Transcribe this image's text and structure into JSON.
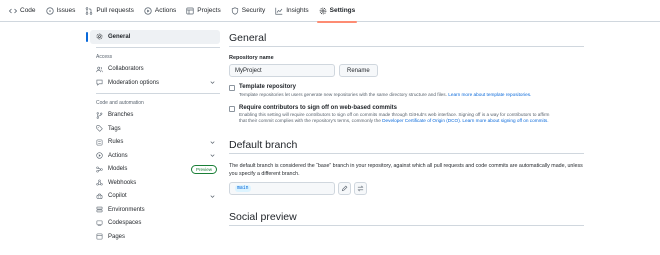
{
  "topnav": {
    "tabs": [
      {
        "label": "Code",
        "icon": "code-icon"
      },
      {
        "label": "Issues",
        "icon": "issue-icon"
      },
      {
        "label": "Pull requests",
        "icon": "pull-request-icon"
      },
      {
        "label": "Actions",
        "icon": "play-icon"
      },
      {
        "label": "Projects",
        "icon": "table-icon"
      },
      {
        "label": "Security",
        "icon": "shield-icon"
      },
      {
        "label": "Insights",
        "icon": "graph-icon"
      },
      {
        "label": "Settings",
        "icon": "gear-icon"
      }
    ],
    "active": "Settings"
  },
  "sidebar": {
    "general": "General",
    "access_heading": "Access",
    "collaborators": "Collaborators",
    "moderation": "Moderation options",
    "code_heading": "Code and automation",
    "branches": "Branches",
    "tags": "Tags",
    "rules": "Rules",
    "actions": "Actions",
    "models": "Models",
    "models_badge": "Preview",
    "webhooks": "Webhooks",
    "copilot": "Copilot",
    "environments": "Environments",
    "codespaces": "Codespaces",
    "pages": "Pages"
  },
  "general": {
    "title": "General",
    "repo_name_label": "Repository name",
    "repo_name_value": "MyProject",
    "rename_button": "Rename",
    "template_title": "Template repository",
    "template_desc": "Template repositories let users generate new repositories with the same directory structure and files.",
    "template_link": "Learn more about template repositories.",
    "signoff_title": "Require contributors to sign off on web-based commits",
    "signoff_desc": "Enabling this setting will require contributors to sign off on commits made through GitHub's web interface. Signing off is a way for contributors to affirm that their commit complies with the repository's terms, commonly the",
    "signoff_link1": "Developer Certificate of Origin (DCO).",
    "signoff_link2": "Learn more about signing off on commits."
  },
  "default_branch": {
    "title": "Default branch",
    "description": "The default branch is considered the “base” branch in your repository, against which all pull requests and code commits are automatically made, unless you specify a different branch.",
    "branch": "main"
  },
  "social_preview": {
    "title": "Social preview"
  },
  "colors": {
    "accent": "#0969da",
    "active_tab_underline": "#fd8c73",
    "preview_badge": "#1a7f37"
  }
}
